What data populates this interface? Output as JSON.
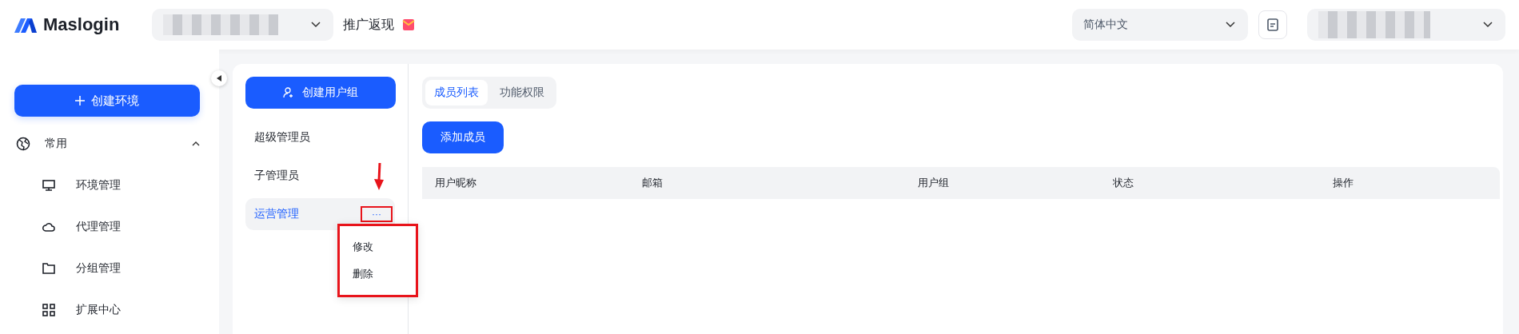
{
  "header": {
    "brand": "Maslogin",
    "promo": "推广返现",
    "language": "简体中文"
  },
  "sidebar": {
    "create_button": "创建环境",
    "section": {
      "label": "常用",
      "expanded": true,
      "items": [
        {
          "label": "环境管理"
        },
        {
          "label": "代理管理"
        },
        {
          "label": "分组管理"
        },
        {
          "label": "扩展中心"
        }
      ]
    }
  },
  "groups": {
    "create_button": "创建用户组",
    "items": [
      {
        "label": "超级管理员",
        "selected": false
      },
      {
        "label": "子管理员",
        "selected": false
      },
      {
        "label": "运营管理",
        "selected": true,
        "more": "···",
        "more_framed": true
      }
    ],
    "arrow": true,
    "menu": {
      "framed": true,
      "items": [
        "修改",
        "删除"
      ]
    }
  },
  "members": {
    "tabs": [
      {
        "label": "成员列表",
        "selected": true
      },
      {
        "label": "功能权限",
        "selected": false
      }
    ],
    "add_button": "添加成员",
    "columns": [
      "用户昵称",
      "邮箱",
      "用户组",
      "状态",
      "操作"
    ]
  }
}
